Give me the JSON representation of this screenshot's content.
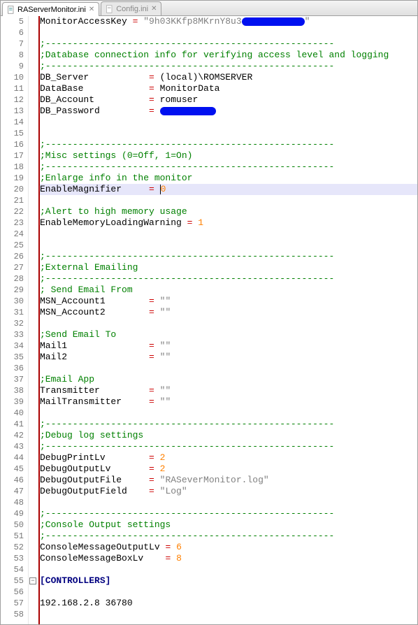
{
  "tabs": [
    {
      "label": "RAServerMonitor.ini",
      "active": true
    },
    {
      "label": "Config.ini",
      "active": false
    }
  ],
  "startLine": 5,
  "activeLine": 20,
  "foldLine": 55,
  "lines": [
    {
      "n": 5,
      "cells": [
        [
          "k",
          "MonitorAccessKey "
        ],
        [
          "op",
          "="
        ],
        [
          "s",
          " \"9h03KKfp8MKrnY8u3"
        ],
        [
          "redact",
          90
        ],
        [
          "s",
          "\""
        ]
      ]
    },
    {
      "n": 6,
      "cells": []
    },
    {
      "n": 7,
      "cells": [
        [
          "g",
          ";-----------------------------------------------------"
        ]
      ]
    },
    {
      "n": 8,
      "cells": [
        [
          "g",
          ";Database connection info for verifying access level and logging"
        ]
      ]
    },
    {
      "n": 9,
      "cells": [
        [
          "g",
          ";-----------------------------------------------------"
        ]
      ]
    },
    {
      "n": 10,
      "cells": [
        [
          "k",
          "DB_Server           "
        ],
        [
          "op",
          "="
        ],
        [
          "k",
          " (local)\\ROMSERVER"
        ]
      ]
    },
    {
      "n": 11,
      "cells": [
        [
          "k",
          "DataBase            "
        ],
        [
          "op",
          "="
        ],
        [
          "k",
          " MonitorData"
        ]
      ]
    },
    {
      "n": 12,
      "cells": [
        [
          "k",
          "DB_Account          "
        ],
        [
          "op",
          "="
        ],
        [
          "k",
          " romuser"
        ]
      ]
    },
    {
      "n": 13,
      "cells": [
        [
          "k",
          "DB_Password         "
        ],
        [
          "op",
          "="
        ],
        [
          "k",
          " "
        ],
        [
          "redact",
          80
        ]
      ]
    },
    {
      "n": 14,
      "cells": []
    },
    {
      "n": 15,
      "cells": []
    },
    {
      "n": 16,
      "cells": [
        [
          "g",
          ";-----------------------------------------------------"
        ]
      ]
    },
    {
      "n": 17,
      "cells": [
        [
          "g",
          ";Misc settings (0=Off, 1=On)"
        ]
      ]
    },
    {
      "n": 18,
      "cells": [
        [
          "g",
          ";-----------------------------------------------------"
        ]
      ]
    },
    {
      "n": 19,
      "cells": [
        [
          "g",
          ";Enlarge info in the monitor"
        ]
      ]
    },
    {
      "n": 20,
      "cells": [
        [
          "k",
          "EnableMagnifier     "
        ],
        [
          "op",
          "= "
        ],
        [
          "cursor",
          ""
        ],
        [
          "num",
          "0"
        ]
      ]
    },
    {
      "n": 21,
      "cells": []
    },
    {
      "n": 22,
      "cells": [
        [
          "g",
          ";Alert to high memory usage"
        ]
      ]
    },
    {
      "n": 23,
      "cells": [
        [
          "k",
          "EnableMemoryLoadingWarning "
        ],
        [
          "op",
          "="
        ],
        [
          "k",
          " "
        ],
        [
          "num",
          "1"
        ]
      ]
    },
    {
      "n": 24,
      "cells": []
    },
    {
      "n": 25,
      "cells": []
    },
    {
      "n": 26,
      "cells": [
        [
          "g",
          ";-----------------------------------------------------"
        ]
      ]
    },
    {
      "n": 27,
      "cells": [
        [
          "g",
          ";External Emailing"
        ]
      ]
    },
    {
      "n": 28,
      "cells": [
        [
          "g",
          ";-----------------------------------------------------"
        ]
      ]
    },
    {
      "n": 29,
      "cells": [
        [
          "g",
          "; Send Email From"
        ]
      ]
    },
    {
      "n": 30,
      "cells": [
        [
          "k",
          "MSN_Account1        "
        ],
        [
          "op",
          "="
        ],
        [
          "s",
          " \"\""
        ]
      ]
    },
    {
      "n": 31,
      "cells": [
        [
          "k",
          "MSN_Account2        "
        ],
        [
          "op",
          "="
        ],
        [
          "s",
          " \"\""
        ]
      ]
    },
    {
      "n": 32,
      "cells": []
    },
    {
      "n": 33,
      "cells": [
        [
          "g",
          ";Send Email To"
        ]
      ]
    },
    {
      "n": 34,
      "cells": [
        [
          "k",
          "Mail1               "
        ],
        [
          "op",
          "="
        ],
        [
          "s",
          " \"\""
        ]
      ]
    },
    {
      "n": 35,
      "cells": [
        [
          "k",
          "Mail2               "
        ],
        [
          "op",
          "="
        ],
        [
          "s",
          " \"\""
        ]
      ]
    },
    {
      "n": 36,
      "cells": []
    },
    {
      "n": 37,
      "cells": [
        [
          "g",
          ";Email App"
        ]
      ]
    },
    {
      "n": 38,
      "cells": [
        [
          "k",
          "Transmitter         "
        ],
        [
          "op",
          "="
        ],
        [
          "s",
          " \"\""
        ]
      ]
    },
    {
      "n": 39,
      "cells": [
        [
          "k",
          "MailTransmitter     "
        ],
        [
          "op",
          "="
        ],
        [
          "s",
          " \"\""
        ]
      ]
    },
    {
      "n": 40,
      "cells": []
    },
    {
      "n": 41,
      "cells": [
        [
          "g",
          ";-----------------------------------------------------"
        ]
      ]
    },
    {
      "n": 42,
      "cells": [
        [
          "g",
          ";Debug log settings"
        ]
      ]
    },
    {
      "n": 43,
      "cells": [
        [
          "g",
          ";-----------------------------------------------------"
        ]
      ]
    },
    {
      "n": 44,
      "cells": [
        [
          "k",
          "DebugPrintLv        "
        ],
        [
          "op",
          "="
        ],
        [
          "k",
          " "
        ],
        [
          "num",
          "2"
        ]
      ]
    },
    {
      "n": 45,
      "cells": [
        [
          "k",
          "DebugOutputLv       "
        ],
        [
          "op",
          "="
        ],
        [
          "k",
          " "
        ],
        [
          "num",
          "2"
        ]
      ]
    },
    {
      "n": 46,
      "cells": [
        [
          "k",
          "DebugOutputFile     "
        ],
        [
          "op",
          "="
        ],
        [
          "s",
          " \"RASeverMonitor.log\""
        ]
      ]
    },
    {
      "n": 47,
      "cells": [
        [
          "k",
          "DebugOutputField    "
        ],
        [
          "op",
          "="
        ],
        [
          "s",
          " \"Log\""
        ]
      ]
    },
    {
      "n": 48,
      "cells": []
    },
    {
      "n": 49,
      "cells": [
        [
          "g",
          ";-----------------------------------------------------"
        ]
      ]
    },
    {
      "n": 50,
      "cells": [
        [
          "g",
          ";Console Output settings"
        ]
      ]
    },
    {
      "n": 51,
      "cells": [
        [
          "g",
          ";-----------------------------------------------------"
        ]
      ]
    },
    {
      "n": 52,
      "cells": [
        [
          "k",
          "ConsoleMessageOutputLv "
        ],
        [
          "op",
          "="
        ],
        [
          "k",
          " "
        ],
        [
          "num",
          "6"
        ]
      ]
    },
    {
      "n": 53,
      "cells": [
        [
          "k",
          "ConsoleMessageBoxLv    "
        ],
        [
          "op",
          "="
        ],
        [
          "k",
          " "
        ],
        [
          "num",
          "8"
        ]
      ]
    },
    {
      "n": 54,
      "cells": []
    },
    {
      "n": 55,
      "cells": [
        [
          "sect",
          "[CONTROLLERS]"
        ]
      ]
    },
    {
      "n": 56,
      "cells": []
    },
    {
      "n": 57,
      "cells": [
        [
          "k",
          "192.168.2.8 36780"
        ]
      ]
    },
    {
      "n": 58,
      "cells": []
    }
  ]
}
